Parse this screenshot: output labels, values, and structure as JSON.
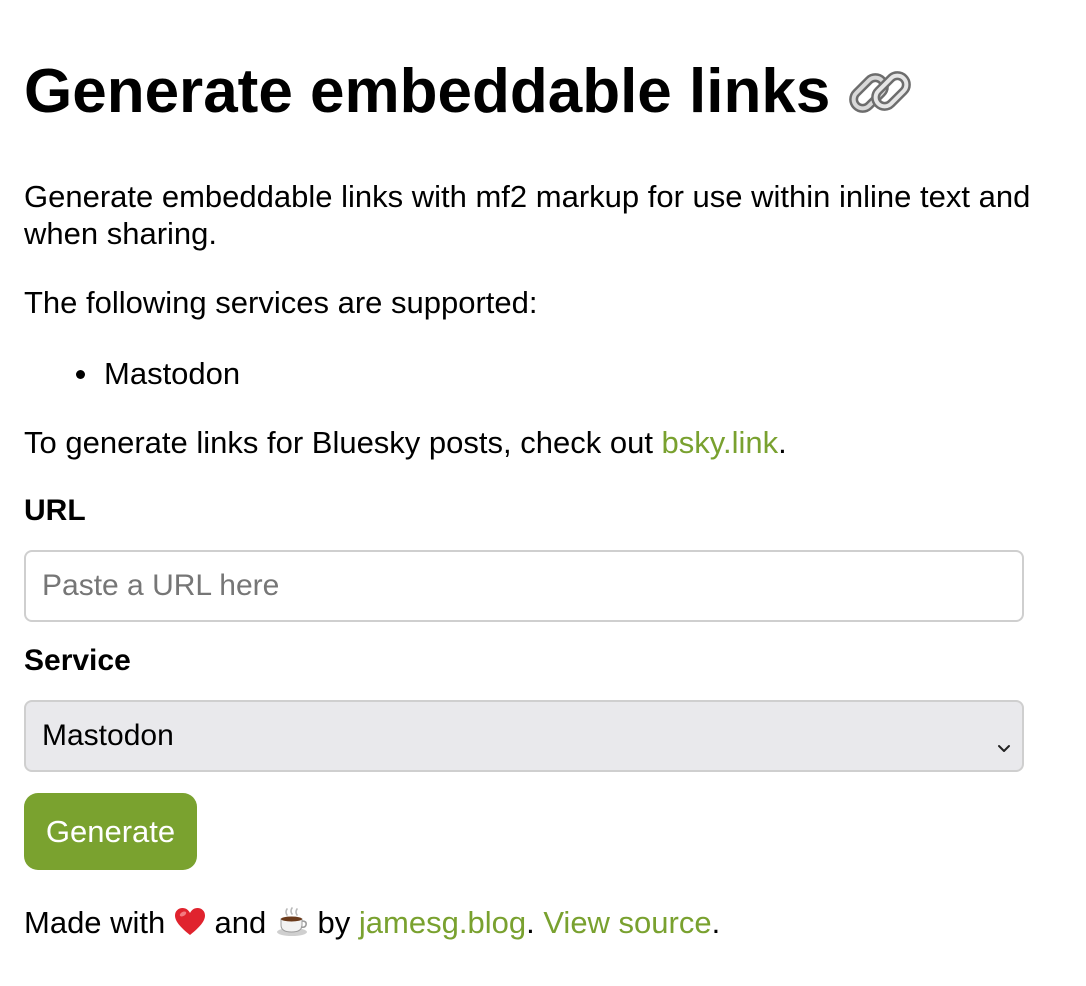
{
  "header": {
    "title": "Generate embeddable links",
    "title_icon": "link-icon"
  },
  "intro": {
    "text": "Generate embeddable links with mf2 markup for use within inline text and when sharing."
  },
  "services": {
    "intro": "The following services are supported:",
    "items": [
      {
        "label": "Mastodon"
      }
    ]
  },
  "bluesky": {
    "prefix": "To generate links for Bluesky posts, check out ",
    "link_label": "bsky.link",
    "suffix": "."
  },
  "form": {
    "url_label": "URL",
    "url_placeholder": "Paste a URL here",
    "url_value": "",
    "service_label": "Service",
    "service_selected": "Mastodon",
    "generate_label": "Generate"
  },
  "footer": {
    "made_with": "Made with",
    "heart_icon": "heart-icon",
    "and": "and",
    "coffee_icon": "coffee-icon",
    "by": "by",
    "author_link": "jamesg.blog",
    "separator": ".",
    "source_link": "View source",
    "end": "."
  },
  "colors": {
    "link": "#79a12f",
    "button": "#7aa22f",
    "select_bg": "#e9e9ec",
    "input_border": "#cfcfcf"
  }
}
